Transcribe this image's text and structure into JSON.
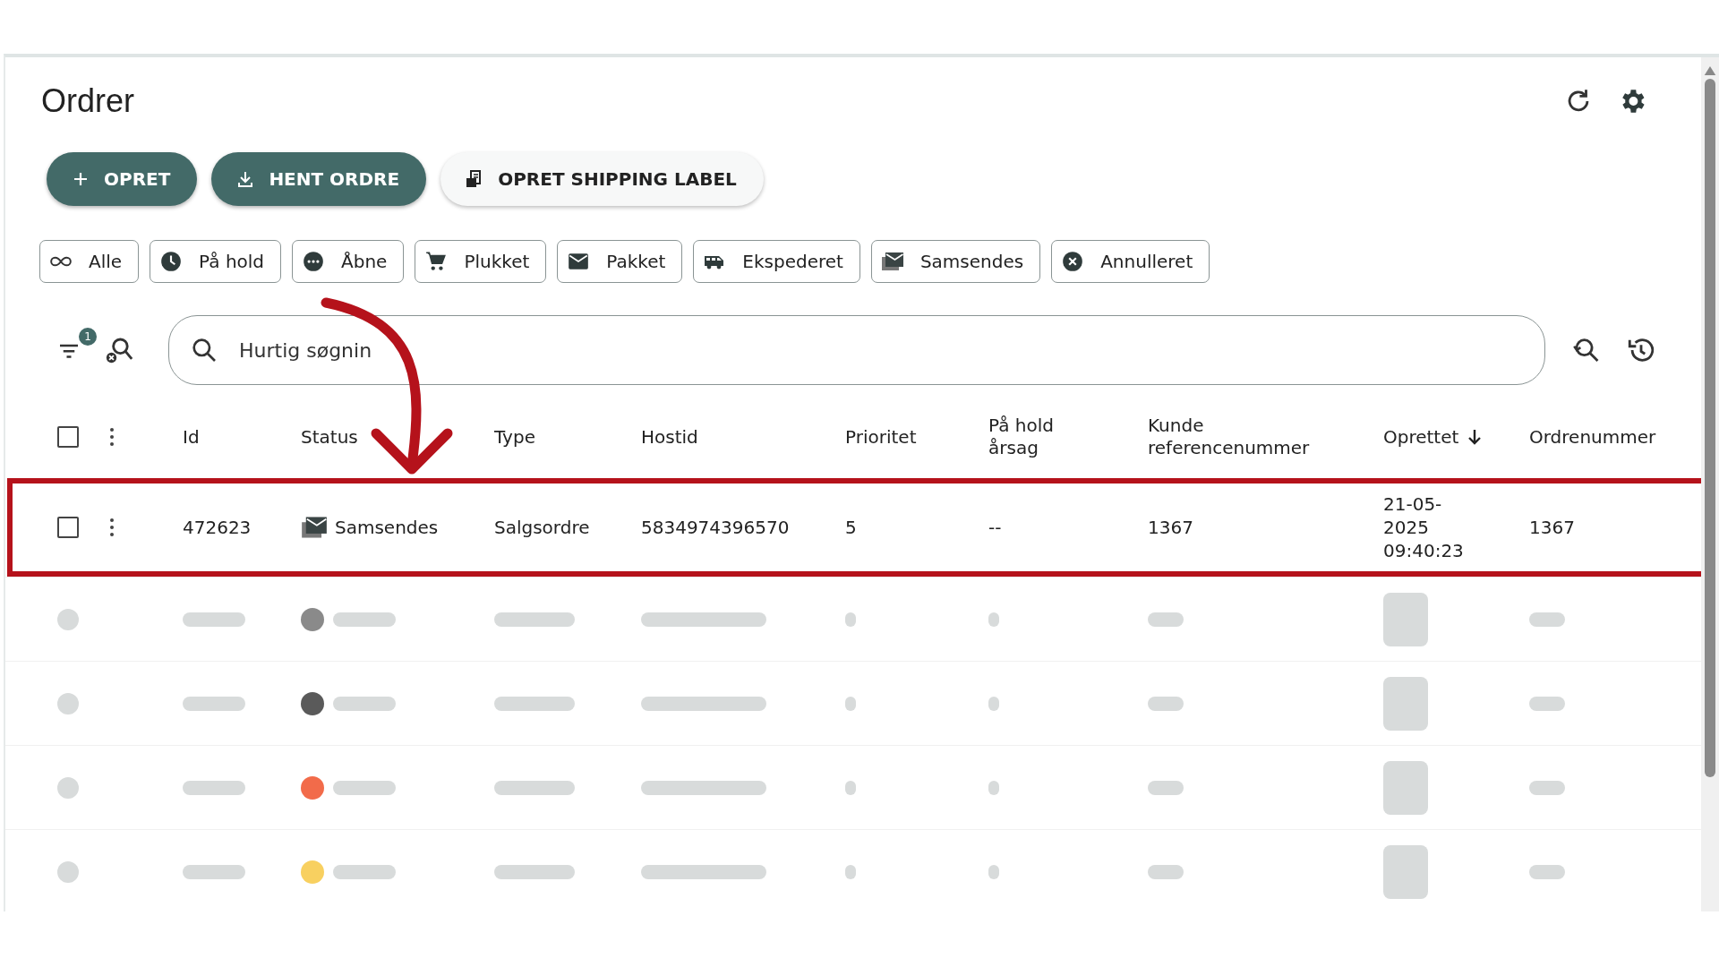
{
  "page": {
    "title": "Ordrer"
  },
  "actions": [
    {
      "label": "OPRET",
      "kind": "primary"
    },
    {
      "label": "HENT ORDRE",
      "kind": "primary"
    },
    {
      "label": "OPRET SHIPPING LABEL",
      "kind": "secondary"
    }
  ],
  "filters": [
    {
      "label": "Alle",
      "selected": false
    },
    {
      "label": "På hold",
      "selected": false
    },
    {
      "label": "Åbne",
      "selected": false
    },
    {
      "label": "Plukket",
      "selected": false
    },
    {
      "label": "Pakket",
      "selected": false
    },
    {
      "label": "Ekspederet",
      "selected": false
    },
    {
      "label": "Samsendes",
      "selected": false
    },
    {
      "label": "Annulleret",
      "selected": false
    }
  ],
  "filter_badge": "1",
  "search": {
    "placeholder": "Hurtig søgnin"
  },
  "table": {
    "select_all_checked": false,
    "columns": [
      {
        "label": "Id",
        "sorted": false
      },
      {
        "label": "Status",
        "sorted": false
      },
      {
        "label": "Type",
        "sorted": false
      },
      {
        "label": "Hostid",
        "sorted": false
      },
      {
        "label": "Prioritet",
        "sorted": false
      },
      {
        "label": "På hold årsag",
        "sorted": false
      },
      {
        "label": "Kunde referencenummer",
        "sorted": false
      },
      {
        "label": "Oprettet",
        "sorted": true
      },
      {
        "label": "Ordrenummer",
        "sorted": false
      }
    ],
    "rows": [
      {
        "checked": false,
        "id": "472623",
        "status": "Samsendes",
        "type": "Salgsordre",
        "hostid": "5834974396570",
        "prioritet": "5",
        "pahold": "--",
        "kunderef": "1367",
        "oprettet": "21-05-2025 09:40:23",
        "ordrenummer": "1367"
      }
    ],
    "blurred_rows": [
      {
        "checked": false,
        "color": "#8a8a8a"
      },
      {
        "checked": false,
        "color": "#5a5a5a"
      },
      {
        "checked": false,
        "color": "#f26b4a"
      },
      {
        "checked": false,
        "color": "#f8d060"
      }
    ]
  }
}
